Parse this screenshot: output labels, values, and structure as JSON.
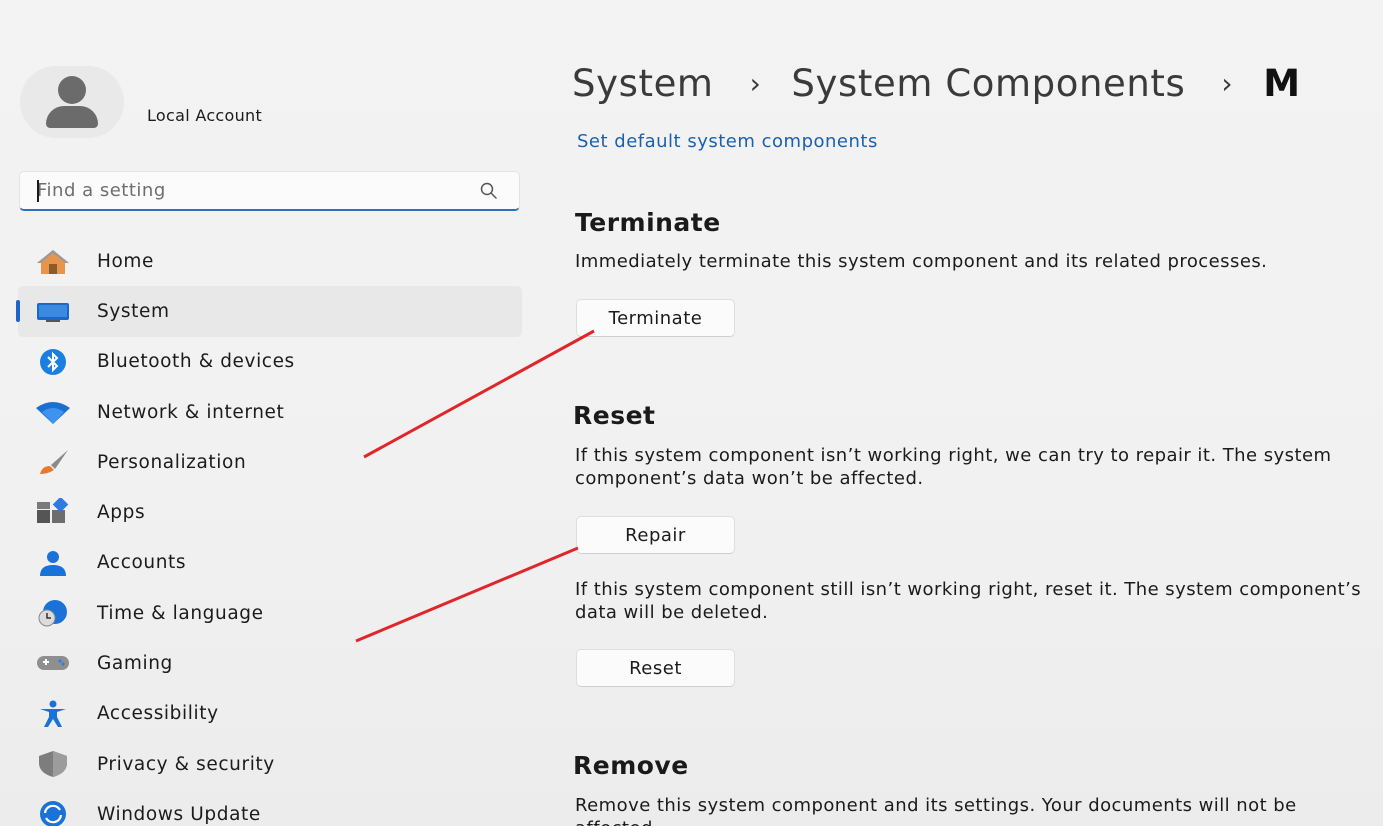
{
  "profile": {
    "name": "Local Account"
  },
  "search": {
    "placeholder": "Find a setting"
  },
  "sidebar": {
    "items": [
      {
        "label": "Home",
        "icon": "home-icon"
      },
      {
        "label": "System",
        "icon": "system-icon",
        "selected": true
      },
      {
        "label": "Bluetooth & devices",
        "icon": "bluetooth-icon"
      },
      {
        "label": "Network & internet",
        "icon": "wifi-icon"
      },
      {
        "label": "Personalization",
        "icon": "brush-icon"
      },
      {
        "label": "Apps",
        "icon": "apps-icon"
      },
      {
        "label": "Accounts",
        "icon": "person-icon"
      },
      {
        "label": "Time & language",
        "icon": "clock-globe-icon"
      },
      {
        "label": "Gaming",
        "icon": "gamepad-icon"
      },
      {
        "label": "Accessibility",
        "icon": "accessibility-icon"
      },
      {
        "label": "Privacy & security",
        "icon": "shield-icon"
      },
      {
        "label": "Windows Update",
        "icon": "update-icon"
      }
    ]
  },
  "breadcrumb": {
    "level1": "System",
    "level2": "System Components",
    "level3": "M"
  },
  "main": {
    "link": "Set default system components",
    "terminate": {
      "heading": "Terminate",
      "description": "Immediately terminate this system component and its related processes.",
      "button": "Terminate"
    },
    "reset": {
      "heading": "Reset",
      "repair_description": "If this system component isn’t working right, we can try to repair it. The system component’s data won’t be affected.",
      "repair_button": "Repair",
      "reset_description": "If this system component still isn’t working right, reset it. The system component’s data will be deleted.",
      "reset_button": "Reset"
    },
    "remove": {
      "heading": "Remove",
      "description": "Remove this system component and its settings. Your documents will not be affected."
    }
  },
  "colors": {
    "accent": "#1f66c4",
    "annotation": "#e0262b",
    "link": "#1b5fb3"
  }
}
